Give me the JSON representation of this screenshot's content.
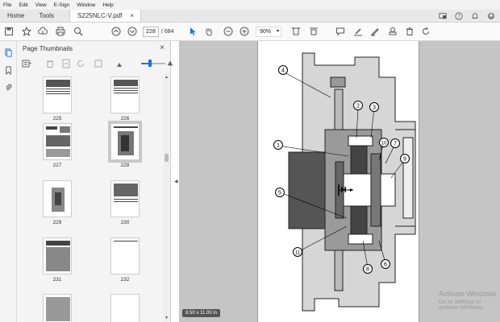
{
  "menu": [
    "File",
    "Edit",
    "View",
    "E-Sign",
    "Window",
    "Help"
  ],
  "tabs": {
    "home": "Home",
    "tools": "Tools",
    "document": "S225NLC-V.pdf",
    "close_glyph": "×"
  },
  "toolbar": {
    "current_page": "228",
    "page_total": "/ 684",
    "zoom": "90%"
  },
  "panel": {
    "title": "Page Thumbnails",
    "close_glyph": "×",
    "thumbnails": [
      {
        "label": "225"
      },
      {
        "label": "226"
      },
      {
        "label": "227"
      },
      {
        "label": "228",
        "selected": true
      },
      {
        "label": "229"
      },
      {
        "label": "230"
      },
      {
        "label": "231"
      },
      {
        "label": "232"
      }
    ]
  },
  "document": {
    "page_size": "8.50 x 11.00 in",
    "callouts": [
      "1",
      "2",
      "3",
      "4",
      "5",
      "6",
      "7",
      "8",
      "9",
      "10",
      "11"
    ],
    "dimension_label": "H"
  },
  "overlay": {
    "line1": "Activate Windows",
    "line2": "Go to Settings to activate Windows."
  },
  "colors": {
    "accent": "#1473e6",
    "doc_background": "#c5c5c5"
  }
}
